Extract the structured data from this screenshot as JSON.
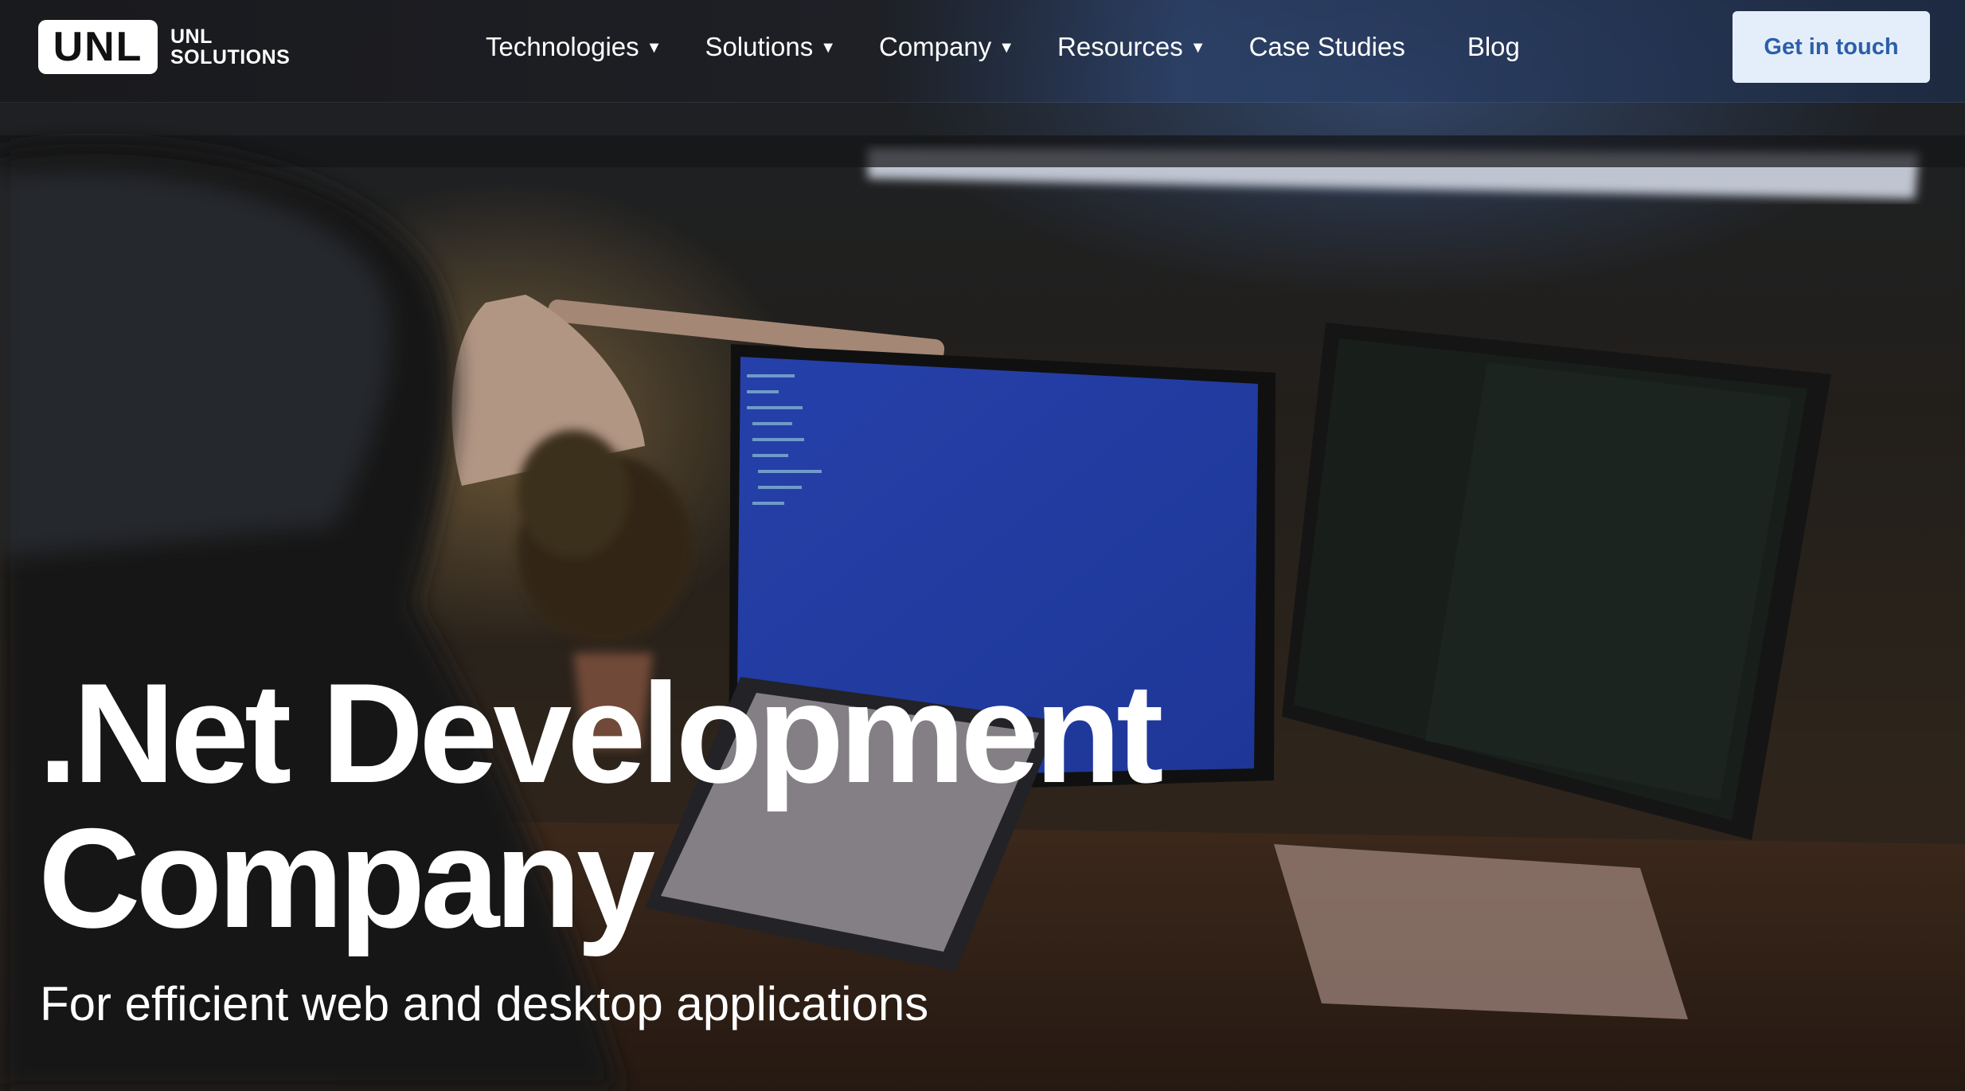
{
  "brand": {
    "logo_mark": "UNL",
    "logo_line1": "UNL",
    "logo_line2": "SOLUTIONS"
  },
  "nav": {
    "items": [
      {
        "label": "Technologies",
        "has_dropdown": true
      },
      {
        "label": "Solutions",
        "has_dropdown": true
      },
      {
        "label": "Company",
        "has_dropdown": true
      },
      {
        "label": "Resources",
        "has_dropdown": true
      },
      {
        "label": "Case Studies",
        "has_dropdown": false
      },
      {
        "label": "Blog",
        "has_dropdown": false
      }
    ],
    "dropdown_icon": "caret-down-icon",
    "cta_label": "Get in touch"
  },
  "hero": {
    "title_line1": ".Net Development",
    "title_line2": "Company",
    "subtitle": "For efficient web and desktop applications"
  },
  "colors": {
    "cta_bg": "#e4eefb",
    "cta_text": "#2b5fa8",
    "text": "#ffffff"
  }
}
